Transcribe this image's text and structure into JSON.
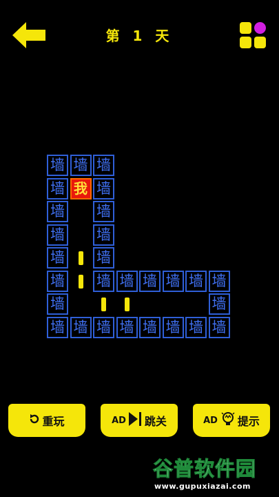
{
  "header": {
    "title": "第 1 天",
    "back_icon": "arrow-left-icon",
    "menu_icon": "grid-menu-icon"
  },
  "board": {
    "wall_char": "墙",
    "player_char": "我",
    "wall_color": "#2f5fd8",
    "player_color": "#e8180c"
  },
  "buttons": {
    "replay": {
      "label": "重玩",
      "icon": "restart-icon"
    },
    "skip": {
      "tag": "AD",
      "label": "跳关",
      "icon": "skip-icon"
    },
    "hint": {
      "tag": "AD",
      "label": "提示",
      "icon": "lightbulb-icon"
    }
  },
  "watermark": {
    "main": "谷普软件园",
    "sub": "www.gupuxiazai.com"
  },
  "colors": {
    "accent": "#f5e60a",
    "background": "#000000"
  }
}
